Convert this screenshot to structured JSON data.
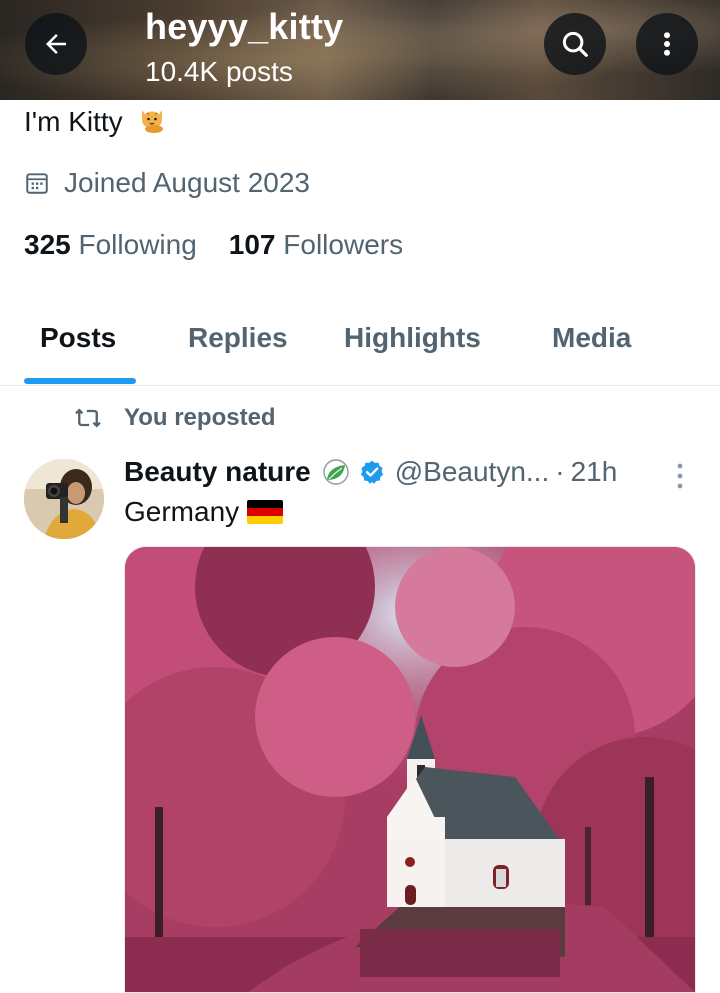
{
  "header": {
    "title": "heyyy_kitty",
    "subtitle": "10.4K posts"
  },
  "profile": {
    "bio": "I'm Kitty",
    "bio_emoji": "cat-emoji",
    "joined": "Joined August 2023",
    "following_count": "325",
    "following_label": "Following",
    "followers_count": "107",
    "followers_label": "Followers"
  },
  "tabs": [
    {
      "label": "Posts",
      "active": true
    },
    {
      "label": "Replies",
      "active": false
    },
    {
      "label": "Highlights",
      "active": false
    },
    {
      "label": "Media",
      "active": false
    }
  ],
  "post": {
    "repost_label": "You reposted",
    "author_name": "Beauty nature",
    "handle": "@Beautyn...",
    "separator": "·",
    "time": "21h",
    "text": "Germany",
    "flag": "germany-flag"
  },
  "colors": {
    "accent": "#1d9bf0",
    "text_primary": "#0f1419",
    "text_secondary": "#536471",
    "foliage": "#b8456e"
  }
}
